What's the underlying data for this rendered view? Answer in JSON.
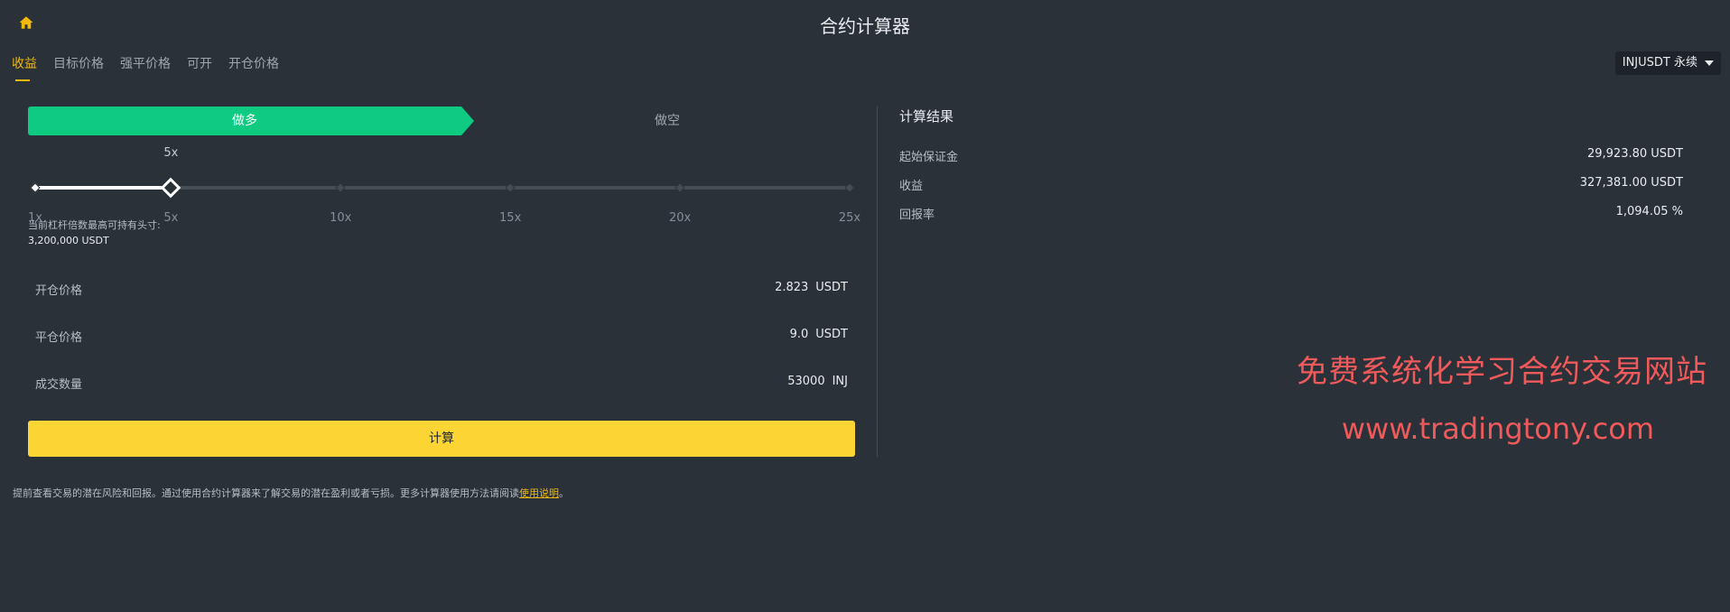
{
  "header": {
    "title": "合约计算器",
    "home_icon": "home-icon"
  },
  "tabs": [
    {
      "label": "收益",
      "active": true
    },
    {
      "label": "目标价格",
      "active": false
    },
    {
      "label": "强平价格",
      "active": false
    },
    {
      "label": "可开",
      "active": false
    },
    {
      "label": "开仓价格",
      "active": false
    }
  ],
  "contract": {
    "selected": "INJUSDT 永续"
  },
  "side": {
    "long_label": "做多",
    "short_label": "做空",
    "selected": "long"
  },
  "leverage": {
    "current_label": "5x",
    "current": 5,
    "min": 1,
    "max": 25,
    "ticks": [
      "1x",
      "5x",
      "10x",
      "15x",
      "20x",
      "25x"
    ]
  },
  "max_position": {
    "label": "当前杠杆倍数最高可持有头寸:",
    "value": "3,200,000 USDT"
  },
  "inputs": {
    "entry_price": {
      "label": "开仓价格",
      "value": "2.823",
      "unit": "USDT"
    },
    "exit_price": {
      "label": "平仓价格",
      "value": "9.0",
      "unit": "USDT"
    },
    "quantity": {
      "label": "成交数量",
      "value": "53000",
      "unit": "INJ"
    }
  },
  "calculate_label": "计算",
  "results": {
    "title": "计算结果",
    "rows": [
      {
        "label": "起始保证金",
        "value": "29,923.80 USDT"
      },
      {
        "label": "收益",
        "value": "327,381.00 USDT"
      },
      {
        "label": "回报率",
        "value": "1,094.05 %"
      }
    ]
  },
  "watermark": {
    "text": "免费系统化学习合约交易网站",
    "url": "www.tradingtony.com"
  },
  "footer": {
    "text": "提前查看交易的潜在风险和回报。通过使用合约计算器来了解交易的潜在盈利或者亏损。更多计算器使用方法请阅读",
    "link": "使用说明",
    "suffix": "。"
  },
  "colors": {
    "background": "#2b3139",
    "accent": "#f0b90b",
    "long_green": "#0ecb81",
    "button_yellow": "#fcd535",
    "watermark_red": "#f05a5a"
  }
}
